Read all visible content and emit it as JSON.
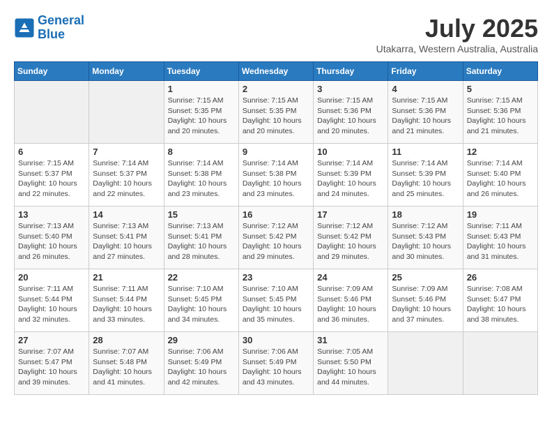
{
  "header": {
    "logo_line1": "General",
    "logo_line2": "Blue",
    "month_year": "July 2025",
    "location": "Utakarra, Western Australia, Australia"
  },
  "weekdays": [
    "Sunday",
    "Monday",
    "Tuesday",
    "Wednesday",
    "Thursday",
    "Friday",
    "Saturday"
  ],
  "weeks": [
    [
      {
        "day": "",
        "sunrise": "",
        "sunset": "",
        "daylight": ""
      },
      {
        "day": "",
        "sunrise": "",
        "sunset": "",
        "daylight": ""
      },
      {
        "day": "1",
        "sunrise": "Sunrise: 7:15 AM",
        "sunset": "Sunset: 5:35 PM",
        "daylight": "Daylight: 10 hours and 20 minutes."
      },
      {
        "day": "2",
        "sunrise": "Sunrise: 7:15 AM",
        "sunset": "Sunset: 5:35 PM",
        "daylight": "Daylight: 10 hours and 20 minutes."
      },
      {
        "day": "3",
        "sunrise": "Sunrise: 7:15 AM",
        "sunset": "Sunset: 5:36 PM",
        "daylight": "Daylight: 10 hours and 20 minutes."
      },
      {
        "day": "4",
        "sunrise": "Sunrise: 7:15 AM",
        "sunset": "Sunset: 5:36 PM",
        "daylight": "Daylight: 10 hours and 21 minutes."
      },
      {
        "day": "5",
        "sunrise": "Sunrise: 7:15 AM",
        "sunset": "Sunset: 5:36 PM",
        "daylight": "Daylight: 10 hours and 21 minutes."
      }
    ],
    [
      {
        "day": "6",
        "sunrise": "Sunrise: 7:15 AM",
        "sunset": "Sunset: 5:37 PM",
        "daylight": "Daylight: 10 hours and 22 minutes."
      },
      {
        "day": "7",
        "sunrise": "Sunrise: 7:14 AM",
        "sunset": "Sunset: 5:37 PM",
        "daylight": "Daylight: 10 hours and 22 minutes."
      },
      {
        "day": "8",
        "sunrise": "Sunrise: 7:14 AM",
        "sunset": "Sunset: 5:38 PM",
        "daylight": "Daylight: 10 hours and 23 minutes."
      },
      {
        "day": "9",
        "sunrise": "Sunrise: 7:14 AM",
        "sunset": "Sunset: 5:38 PM",
        "daylight": "Daylight: 10 hours and 23 minutes."
      },
      {
        "day": "10",
        "sunrise": "Sunrise: 7:14 AM",
        "sunset": "Sunset: 5:39 PM",
        "daylight": "Daylight: 10 hours and 24 minutes."
      },
      {
        "day": "11",
        "sunrise": "Sunrise: 7:14 AM",
        "sunset": "Sunset: 5:39 PM",
        "daylight": "Daylight: 10 hours and 25 minutes."
      },
      {
        "day": "12",
        "sunrise": "Sunrise: 7:14 AM",
        "sunset": "Sunset: 5:40 PM",
        "daylight": "Daylight: 10 hours and 26 minutes."
      }
    ],
    [
      {
        "day": "13",
        "sunrise": "Sunrise: 7:13 AM",
        "sunset": "Sunset: 5:40 PM",
        "daylight": "Daylight: 10 hours and 26 minutes."
      },
      {
        "day": "14",
        "sunrise": "Sunrise: 7:13 AM",
        "sunset": "Sunset: 5:41 PM",
        "daylight": "Daylight: 10 hours and 27 minutes."
      },
      {
        "day": "15",
        "sunrise": "Sunrise: 7:13 AM",
        "sunset": "Sunset: 5:41 PM",
        "daylight": "Daylight: 10 hours and 28 minutes."
      },
      {
        "day": "16",
        "sunrise": "Sunrise: 7:12 AM",
        "sunset": "Sunset: 5:42 PM",
        "daylight": "Daylight: 10 hours and 29 minutes."
      },
      {
        "day": "17",
        "sunrise": "Sunrise: 7:12 AM",
        "sunset": "Sunset: 5:42 PM",
        "daylight": "Daylight: 10 hours and 29 minutes."
      },
      {
        "day": "18",
        "sunrise": "Sunrise: 7:12 AM",
        "sunset": "Sunset: 5:43 PM",
        "daylight": "Daylight: 10 hours and 30 minutes."
      },
      {
        "day": "19",
        "sunrise": "Sunrise: 7:11 AM",
        "sunset": "Sunset: 5:43 PM",
        "daylight": "Daylight: 10 hours and 31 minutes."
      }
    ],
    [
      {
        "day": "20",
        "sunrise": "Sunrise: 7:11 AM",
        "sunset": "Sunset: 5:44 PM",
        "daylight": "Daylight: 10 hours and 32 minutes."
      },
      {
        "day": "21",
        "sunrise": "Sunrise: 7:11 AM",
        "sunset": "Sunset: 5:44 PM",
        "daylight": "Daylight: 10 hours and 33 minutes."
      },
      {
        "day": "22",
        "sunrise": "Sunrise: 7:10 AM",
        "sunset": "Sunset: 5:45 PM",
        "daylight": "Daylight: 10 hours and 34 minutes."
      },
      {
        "day": "23",
        "sunrise": "Sunrise: 7:10 AM",
        "sunset": "Sunset: 5:45 PM",
        "daylight": "Daylight: 10 hours and 35 minutes."
      },
      {
        "day": "24",
        "sunrise": "Sunrise: 7:09 AM",
        "sunset": "Sunset: 5:46 PM",
        "daylight": "Daylight: 10 hours and 36 minutes."
      },
      {
        "day": "25",
        "sunrise": "Sunrise: 7:09 AM",
        "sunset": "Sunset: 5:46 PM",
        "daylight": "Daylight: 10 hours and 37 minutes."
      },
      {
        "day": "26",
        "sunrise": "Sunrise: 7:08 AM",
        "sunset": "Sunset: 5:47 PM",
        "daylight": "Daylight: 10 hours and 38 minutes."
      }
    ],
    [
      {
        "day": "27",
        "sunrise": "Sunrise: 7:07 AM",
        "sunset": "Sunset: 5:47 PM",
        "daylight": "Daylight: 10 hours and 39 minutes."
      },
      {
        "day": "28",
        "sunrise": "Sunrise: 7:07 AM",
        "sunset": "Sunset: 5:48 PM",
        "daylight": "Daylight: 10 hours and 41 minutes."
      },
      {
        "day": "29",
        "sunrise": "Sunrise: 7:06 AM",
        "sunset": "Sunset: 5:49 PM",
        "daylight": "Daylight: 10 hours and 42 minutes."
      },
      {
        "day": "30",
        "sunrise": "Sunrise: 7:06 AM",
        "sunset": "Sunset: 5:49 PM",
        "daylight": "Daylight: 10 hours and 43 minutes."
      },
      {
        "day": "31",
        "sunrise": "Sunrise: 7:05 AM",
        "sunset": "Sunset: 5:50 PM",
        "daylight": "Daylight: 10 hours and 44 minutes."
      },
      {
        "day": "",
        "sunrise": "",
        "sunset": "",
        "daylight": ""
      },
      {
        "day": "",
        "sunrise": "",
        "sunset": "",
        "daylight": ""
      }
    ]
  ]
}
